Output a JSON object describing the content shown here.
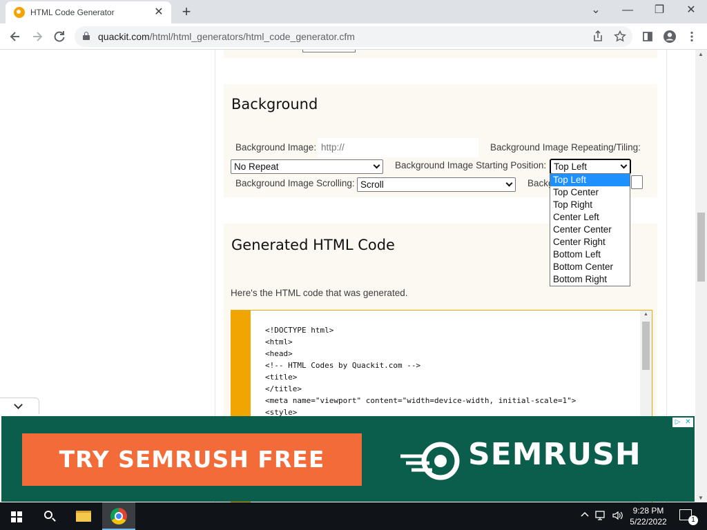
{
  "browser": {
    "tab_title": "HTML Code Generator",
    "tab_close": "✕",
    "new_tab": "+",
    "window_controls": {
      "minimize": "—",
      "maximize": "❐",
      "close": "✕",
      "tab_menu": "⌄"
    },
    "url_host": "quackit.com",
    "url_path": "/html/html_generators/html_code_generator.cfm"
  },
  "icons": {
    "back": "back-arrow-icon",
    "forward": "forward-arrow-icon",
    "reload": "reload-icon",
    "lock": "lock-icon",
    "share": "share-icon",
    "bookmark": "star-icon",
    "sidepanel": "side-panel-icon",
    "profile": "profile-icon",
    "menu": "kebab-menu-icon"
  },
  "background_section": {
    "heading": "Background",
    "bg_image_label": "Background Image:",
    "bg_image_placeholder": "http://",
    "repeat_label": "Background Image Repeating/Tiling:",
    "repeat_value": "No Repeat",
    "position_label": "Background Image Starting Position:",
    "position_value": "Top Left",
    "scroll_label": "Background Image Scrolling:",
    "scroll_value": "Scroll",
    "truncated_label": "Backg"
  },
  "position_dropdown": {
    "options": [
      "Top Left",
      "Top Center",
      "Top Right",
      "Center Left",
      "Center Center",
      "Center Right",
      "Bottom Left",
      "Bottom Center",
      "Bottom Right"
    ],
    "selected_index": 0
  },
  "generated_section": {
    "heading": "Generated HTML Code",
    "intro": "Here's the HTML code that was generated.",
    "code_lines": [
      "<!DOCTYPE html>",
      "<html>",
      "<head>",
      "<!-- HTML Codes by Quackit.com -->",
      "<title>",
      "</title>",
      "<meta name=\"viewport\" content=\"width=device-width, initial-scale=1\">",
      "<style>"
    ]
  },
  "ad": {
    "cta": "TRY SEMRUSH FREE",
    "brand": "SEMRUSH",
    "colors": {
      "background": "#0a5e4b",
      "cta": "#f26b38"
    }
  },
  "taskbar": {
    "time": "9:28 PM",
    "date": "5/22/2022",
    "notification_count": "1"
  }
}
